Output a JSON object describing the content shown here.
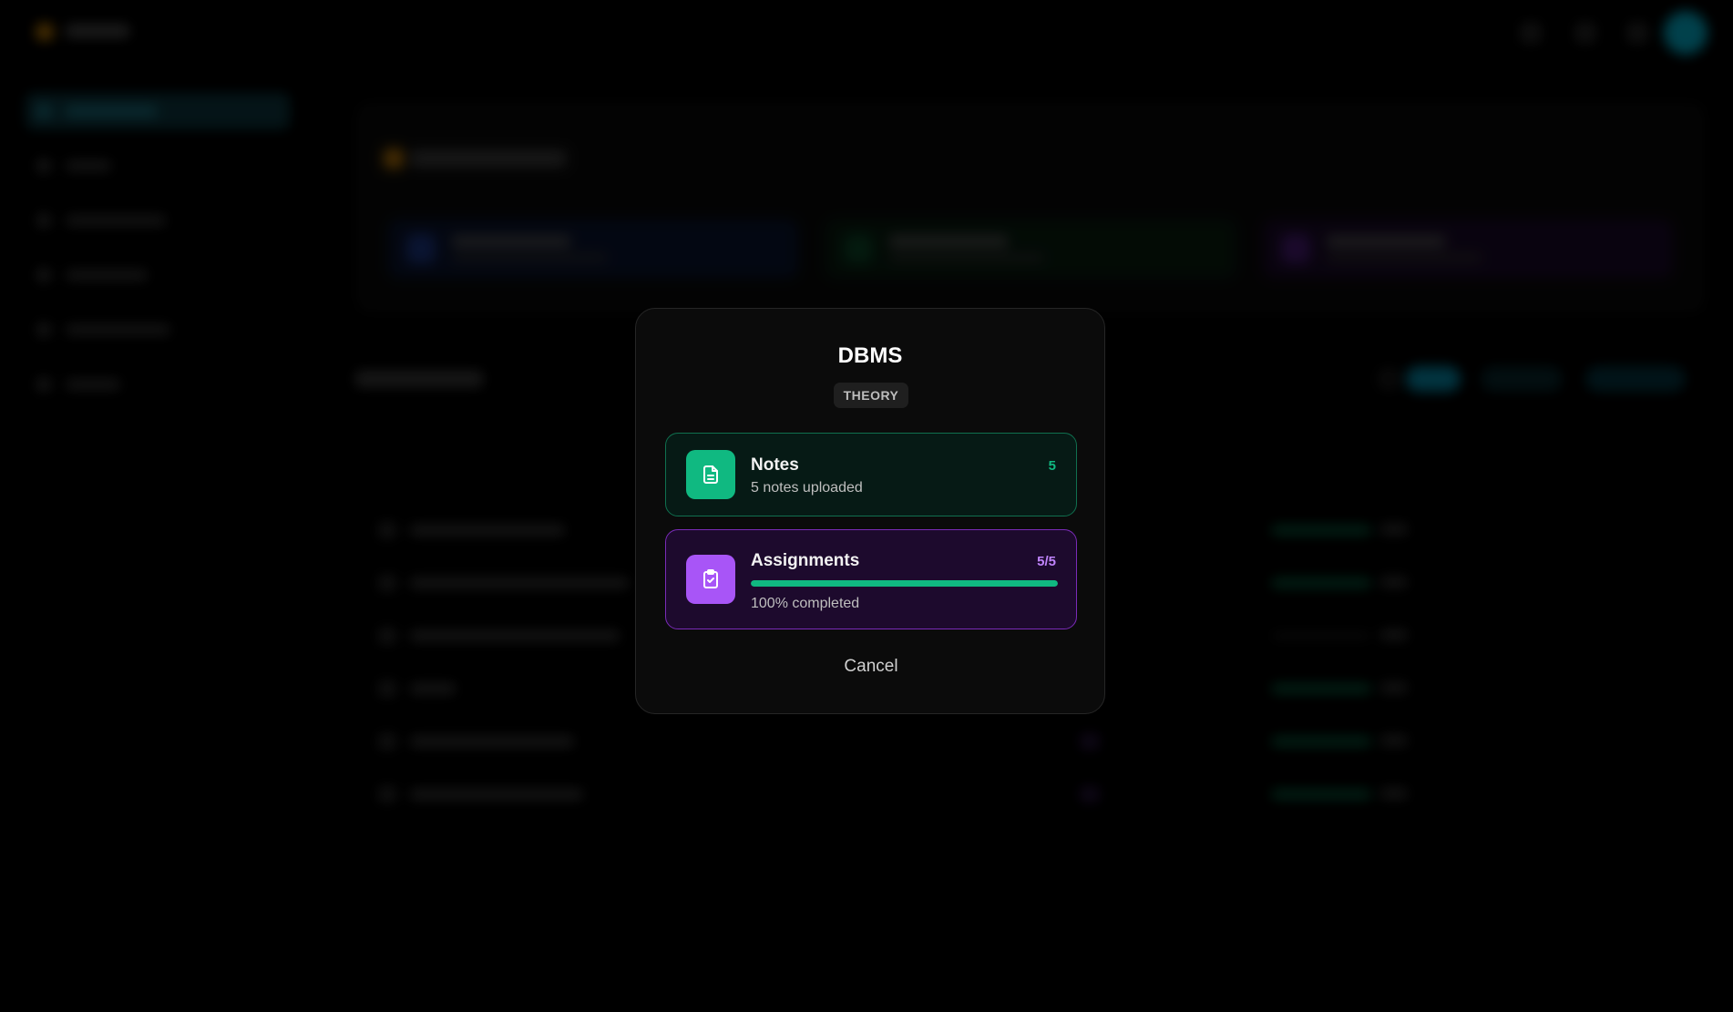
{
  "modal": {
    "title": "DBMS",
    "tag": "THEORY",
    "notes": {
      "icon": "document-icon",
      "label": "Notes",
      "subtitle": "5 notes uploaded",
      "count": "5",
      "color": "#10b981"
    },
    "assignments": {
      "icon": "clipboard-check-icon",
      "label": "Assignments",
      "count": "5/5",
      "progress": 1.0,
      "subtitle": "100% completed",
      "color": "#a855f7"
    },
    "cancel_label": "Cancel"
  }
}
